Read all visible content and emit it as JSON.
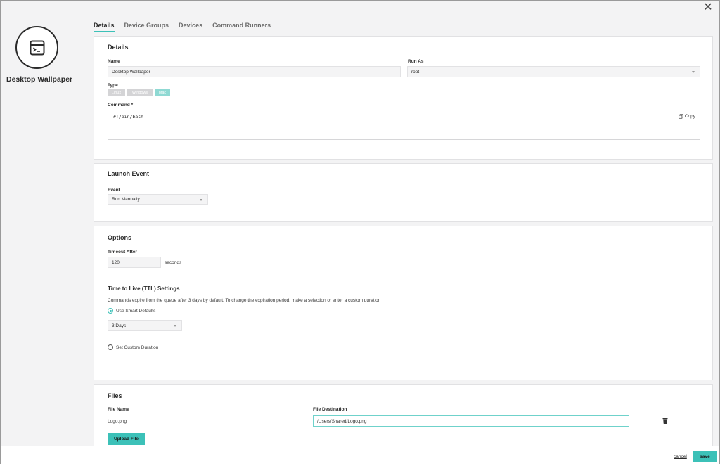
{
  "app": {
    "name": "Desktop Wallpaper",
    "icon": "terminal-window-icon"
  },
  "tabs": [
    {
      "label": "Details",
      "active": true
    },
    {
      "label": "Device Groups",
      "active": false
    },
    {
      "label": "Devices",
      "active": false
    },
    {
      "label": "Command Runners",
      "active": false
    }
  ],
  "details": {
    "title": "Details",
    "name_label": "Name",
    "name_value": "Desktop Wallpaper",
    "run_as_label": "Run As",
    "run_as_value": "root",
    "type_label": "Type",
    "types": [
      "Linux",
      "Windows",
      "Mac"
    ],
    "type_selected": "Mac",
    "command_label": "Command *",
    "command_value": "#!/bin/bash",
    "copy_label": "Copy"
  },
  "launch": {
    "title": "Launch Event",
    "event_label": "Event",
    "event_value": "Run Manually"
  },
  "options": {
    "title": "Options",
    "timeout_label": "Timeout After",
    "timeout_value": "120",
    "timeout_unit": "seconds",
    "ttl_title": "Time to Live (TTL) Settings",
    "ttl_desc": "Commands expire from the queue after 3 days by default. To change the expiration period, make a selection or enter a custom duration",
    "smart_defaults_label": "Use Smart Defaults",
    "smart_defaults_selected": true,
    "ttl_value": "3 Days",
    "custom_duration_label": "Set Custom Duration",
    "custom_duration_selected": false
  },
  "files": {
    "title": "Files",
    "col_name": "File Name",
    "col_dest": "File Destination",
    "rows": [
      {
        "name": "Logo.png",
        "destination": "/Users/Shared/Logo.png"
      }
    ],
    "upload_label": "Upload File"
  },
  "footer": {
    "cancel_label": "cancel",
    "save_label": "save"
  },
  "colors": {
    "accent": "#3cc1b8",
    "disabled_chip": "#d4d4d6"
  }
}
